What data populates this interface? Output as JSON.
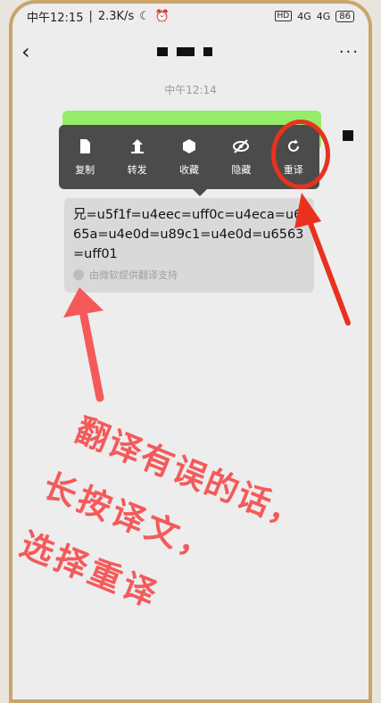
{
  "status": {
    "time": "中午12:15",
    "speed": "2.3K/s",
    "network": "4G",
    "hd": "HD",
    "battery": "86"
  },
  "chat": {
    "timestamp": "中午12:14"
  },
  "menu": {
    "items": [
      {
        "label": "复制",
        "icon": "copy-icon"
      },
      {
        "label": "转发",
        "icon": "forward-icon"
      },
      {
        "label": "收藏",
        "icon": "favorite-icon"
      },
      {
        "label": "隐藏",
        "icon": "hide-icon"
      },
      {
        "label": "重译",
        "icon": "retranslate-icon"
      }
    ]
  },
  "translation": {
    "text": "兄=u5f1f=u4eec=uff0c=u4eca=u665a=u4e0d=u89c1=u4e0d=u6563=uff01",
    "source": "由微软提供翻译支持"
  },
  "annotation": {
    "line1": "翻译有误的话，",
    "line2": "长按译文，",
    "line3": "选择重译"
  },
  "colors": {
    "annotation": "#f45a5a",
    "highlight": "#e8321e",
    "bubble": "#95ec69"
  }
}
